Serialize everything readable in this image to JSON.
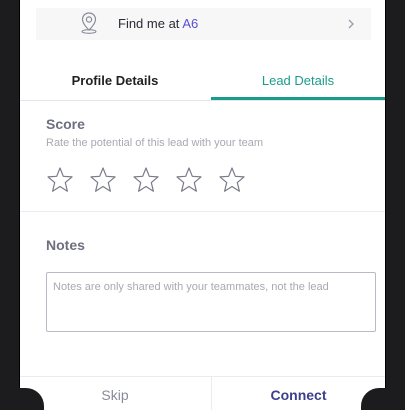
{
  "location_card": {
    "prefix": "Find me at",
    "location": "A6",
    "icon": "location-pin-icon",
    "chevron_icon": "chevron-right-icon"
  },
  "tabs": [
    {
      "label": "Profile Details",
      "active": false
    },
    {
      "label": "Lead Details",
      "active": true
    }
  ],
  "score": {
    "title": "Score",
    "subtitle": "Rate the potential of this lead with your team",
    "rating": 0,
    "max": 5,
    "star_icon": "star-outline-icon"
  },
  "notes": {
    "title": "Notes",
    "value": "",
    "placeholder": "Notes are only shared with your teammates, not the lead"
  },
  "actions": {
    "skip_label": "Skip",
    "connect_label": "Connect"
  },
  "colors": {
    "accent_teal": "#1a9c8c",
    "accent_navy": "#3b3f8c",
    "link_purple": "#5a4fcf"
  }
}
